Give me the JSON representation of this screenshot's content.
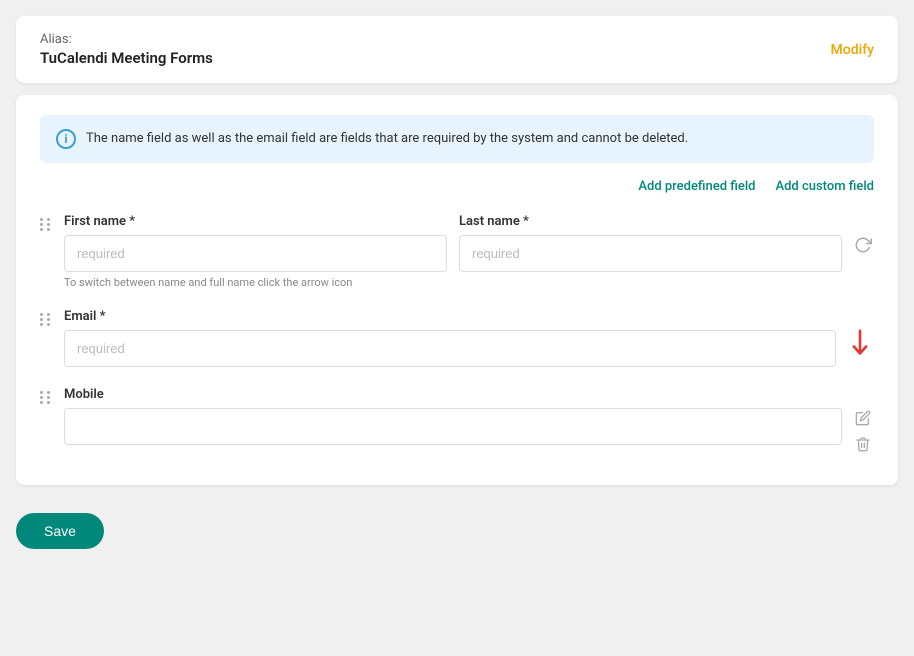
{
  "alias": {
    "label": "Alias:",
    "name": "TuCalendi Meeting Forms",
    "modify_label": "Modify"
  },
  "info_banner": {
    "text": "The name field as well as the email field are fields that are required by the system and cannot be deleted."
  },
  "action_links": {
    "add_predefined": "Add predefined field",
    "add_custom": "Add custom field"
  },
  "fields": [
    {
      "id": "name-group",
      "type": "name-group",
      "first_label": "First name *",
      "last_label": "Last name *",
      "first_placeholder": "required",
      "last_placeholder": "required",
      "hint": "To switch between name and full name click the arrow icon",
      "has_rotate": true
    },
    {
      "id": "email",
      "type": "email",
      "label": "Email *",
      "placeholder": "required",
      "has_down_arrow": true
    },
    {
      "id": "mobile",
      "type": "mobile",
      "label": "Mobile",
      "placeholder": "",
      "has_pencil": true,
      "has_trash": true
    }
  ],
  "footer": {
    "save_label": "Save"
  }
}
